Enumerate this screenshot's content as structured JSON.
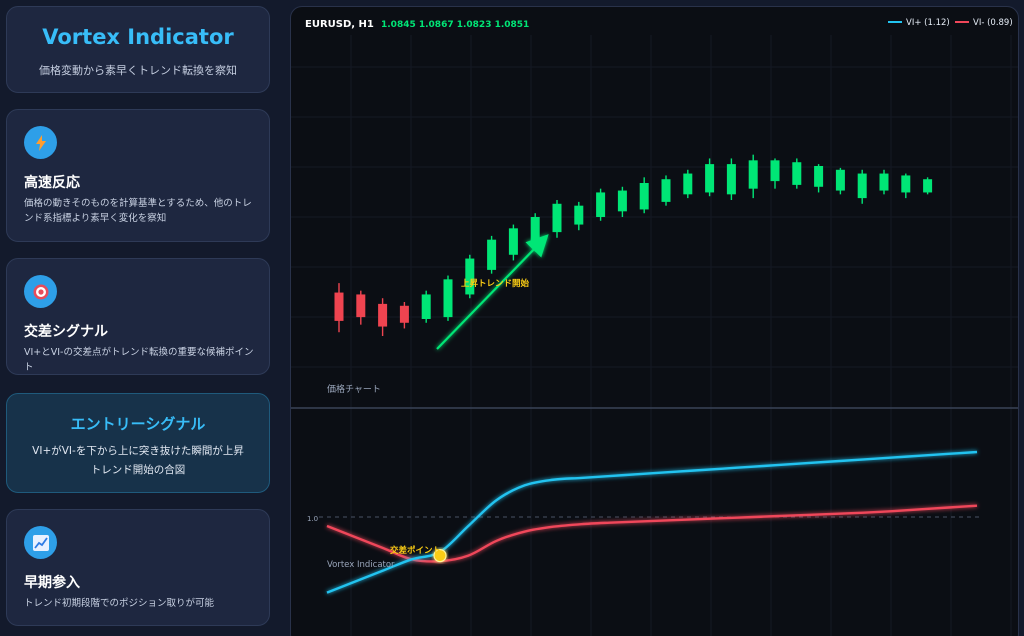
{
  "sidebar": {
    "title": "Vortex Indicator",
    "subtitle": "価格変動から素早くトレンド転換を察知",
    "features": [
      {
        "icon": "lightning-icon",
        "title": "高速反応",
        "desc": "価格の動きそのものを計算基準とするため、他のトレンド系指標より素早く変化を察知"
      },
      {
        "icon": "target-icon",
        "title": "交差シグナル",
        "desc": "VI+とVI-の交差点がトレンド転換の重要な候補ポイント"
      },
      {
        "icon": "chart-up-icon",
        "title": "早期参入",
        "desc": "トレンド初期段階でのポジション取りが可能"
      }
    ],
    "entry": {
      "title": "エントリーシグナル",
      "desc": "VI+がVI-を下から上に突き抜けた瞬間が上昇トレンド開始の合図"
    }
  },
  "chart": {
    "symbol": "EURUSD, H1",
    "ohlc": "1.0845 1.0867 1.0823 1.0851",
    "legend_plus": "VI+ (1.12)",
    "legend_minus": "VI- (0.89)",
    "price_label": "価格チャート",
    "trend_annotation": "上昇トレンド開始",
    "vortex_label": "Vortex Indicator",
    "cross_label": "交差ポイント",
    "baseline_label": "1.0",
    "colors": {
      "up": "#00e676",
      "down": "#ef4450",
      "vi_plus": "#22c3f0",
      "vi_minus": "#f0475a",
      "accent": "#38bdf8",
      "cross": "#facc15"
    }
  },
  "chart_data": [
    {
      "type": "candlestick",
      "title": "EURUSD, H1",
      "annotation": "上昇トレンド開始",
      "candles": [
        {
          "o": 1.079,
          "h": 1.0795,
          "l": 1.0769,
          "c": 1.0775
        },
        {
          "o": 1.0789,
          "h": 1.0791,
          "l": 1.0773,
          "c": 1.0777
        },
        {
          "o": 1.0784,
          "h": 1.0787,
          "l": 1.0767,
          "c": 1.0772
        },
        {
          "o": 1.0783,
          "h": 1.0785,
          "l": 1.0771,
          "c": 1.0774
        },
        {
          "o": 1.0776,
          "h": 1.0791,
          "l": 1.0774,
          "c": 1.0789
        },
        {
          "o": 1.0777,
          "h": 1.0799,
          "l": 1.0775,
          "c": 1.0797
        },
        {
          "o": 1.0789,
          "h": 1.081,
          "l": 1.0787,
          "c": 1.0808
        },
        {
          "o": 1.0802,
          "h": 1.082,
          "l": 1.08,
          "c": 1.0818
        },
        {
          "o": 1.081,
          "h": 1.0826,
          "l": 1.0807,
          "c": 1.0824
        },
        {
          "o": 1.0814,
          "h": 1.0832,
          "l": 1.0813,
          "c": 1.083
        },
        {
          "o": 1.0822,
          "h": 1.0839,
          "l": 1.0819,
          "c": 1.0837
        },
        {
          "o": 1.0826,
          "h": 1.0838,
          "l": 1.0823,
          "c": 1.0836
        },
        {
          "o": 1.083,
          "h": 1.0845,
          "l": 1.0828,
          "c": 1.0843
        },
        {
          "o": 1.0833,
          "h": 1.0846,
          "l": 1.083,
          "c": 1.0844
        },
        {
          "o": 1.0834,
          "h": 1.0851,
          "l": 1.0832,
          "c": 1.0848
        },
        {
          "o": 1.0838,
          "h": 1.0852,
          "l": 1.0836,
          "c": 1.085
        },
        {
          "o": 1.0842,
          "h": 1.0855,
          "l": 1.084,
          "c": 1.0853
        },
        {
          "o": 1.0843,
          "h": 1.0861,
          "l": 1.0841,
          "c": 1.0858
        },
        {
          "o": 1.0842,
          "h": 1.0861,
          "l": 1.0839,
          "c": 1.0858
        },
        {
          "o": 1.0845,
          "h": 1.0863,
          "l": 1.084,
          "c": 1.086
        },
        {
          "o": 1.0849,
          "h": 1.0861,
          "l": 1.0845,
          "c": 1.086
        },
        {
          "o": 1.0847,
          "h": 1.0861,
          "l": 1.0845,
          "c": 1.0859
        },
        {
          "o": 1.0846,
          "h": 1.0858,
          "l": 1.0843,
          "c": 1.0857
        },
        {
          "o": 1.0844,
          "h": 1.0856,
          "l": 1.0842,
          "c": 1.0855
        },
        {
          "o": 1.084,
          "h": 1.0855,
          "l": 1.0837,
          "c": 1.0853
        },
        {
          "o": 1.0844,
          "h": 1.0855,
          "l": 1.0842,
          "c": 1.0853
        },
        {
          "o": 1.0843,
          "h": 1.0853,
          "l": 1.084,
          "c": 1.0852
        },
        {
          "o": 1.0843,
          "h": 1.0851,
          "l": 1.0842,
          "c": 1.085
        }
      ],
      "ylim": [
        1.074,
        1.092
      ]
    },
    {
      "type": "line",
      "title": "Vortex Indicator",
      "baseline": 1.0,
      "ylim": [
        0.78,
        1.38
      ],
      "annotation": "交差ポイント",
      "crossing_index": 4,
      "series": [
        {
          "name": "VI+ (1.12)",
          "values": [
            0.9,
            0.93,
            0.96,
            0.99,
            1.01,
            1.08,
            1.15,
            1.19,
            1.205,
            1.21,
            1.215,
            1.22,
            1.225,
            1.23,
            1.235,
            1.24,
            1.245,
            1.25,
            1.255,
            1.26,
            1.265,
            1.27,
            1.275,
            1.28
          ]
        },
        {
          "name": "VI- (0.89)",
          "values": [
            1.08,
            1.05,
            1.02,
            0.99,
            0.985,
            1.0,
            1.04,
            1.065,
            1.078,
            1.085,
            1.089,
            1.092,
            1.095,
            1.098,
            1.101,
            1.104,
            1.107,
            1.11,
            1.113,
            1.116,
            1.12,
            1.125,
            1.13,
            1.135
          ]
        }
      ]
    }
  ]
}
